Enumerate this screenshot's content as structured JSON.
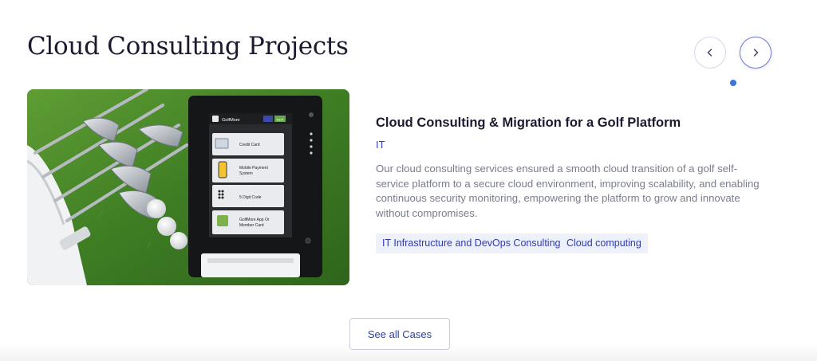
{
  "section": {
    "title": "Cloud Consulting Projects"
  },
  "carousel": {
    "prev_icon": "chevron-left-icon",
    "next_icon": "chevron-right-icon",
    "dots_total": 1,
    "active_dot": 1
  },
  "case": {
    "title": "Cloud Consulting & Migration for a Golf Platform",
    "category": "IT",
    "description": "Our cloud consulting services ensured a smooth cloud transition of a golf self-service platform to a secure cloud environment, improving scalability, and enabling continuous security monitoring, empowering the platform to grow and innovate without compromises.",
    "tags": [
      "IT Infrastructure and DevOps Consulting",
      "Cloud computing"
    ],
    "image": {
      "brand": "GolfMore",
      "lang_badge": "MCP",
      "options": [
        "Credit Card",
        "Mobile Payment System",
        "5 Digit Code",
        "GolfMore App Or Member Card"
      ]
    }
  },
  "cta": {
    "label": "See all Cases"
  },
  "colors": {
    "heading": "#1b1a2e",
    "accent": "#3a45b9",
    "tag_bg": "#eef0fa",
    "dot": "#3b73e0",
    "body_text": "#7a7d8c"
  }
}
